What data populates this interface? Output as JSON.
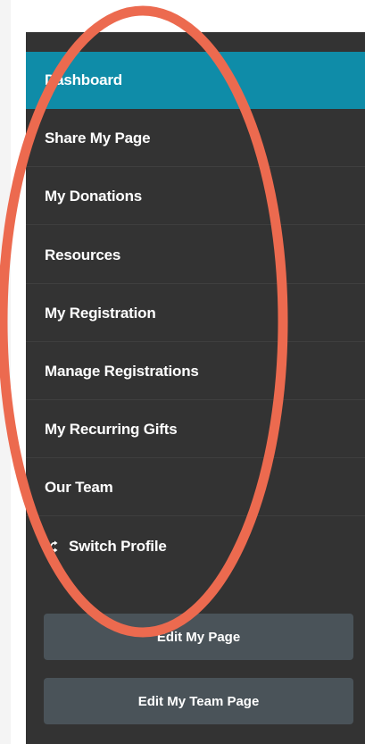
{
  "sidebar": {
    "items": [
      {
        "label": "Dashboard",
        "active": true
      },
      {
        "label": "Share My Page"
      },
      {
        "label": "My Donations"
      },
      {
        "label": "Resources"
      },
      {
        "label": "My Registration"
      },
      {
        "label": "Manage Registrations"
      },
      {
        "label": "My Recurring Gifts"
      },
      {
        "label": "Our Team"
      },
      {
        "label": "Switch Profile",
        "icon": "shuffle-icon"
      }
    ],
    "buttons": {
      "edit_my_page": "Edit My Page",
      "edit_my_team_page": "Edit My Team Page"
    }
  },
  "colors": {
    "sidebar_bg": "#333333",
    "active_bg": "#0f8ca8",
    "button_bg": "#4a5359",
    "annotation": "#ec6a4f"
  }
}
